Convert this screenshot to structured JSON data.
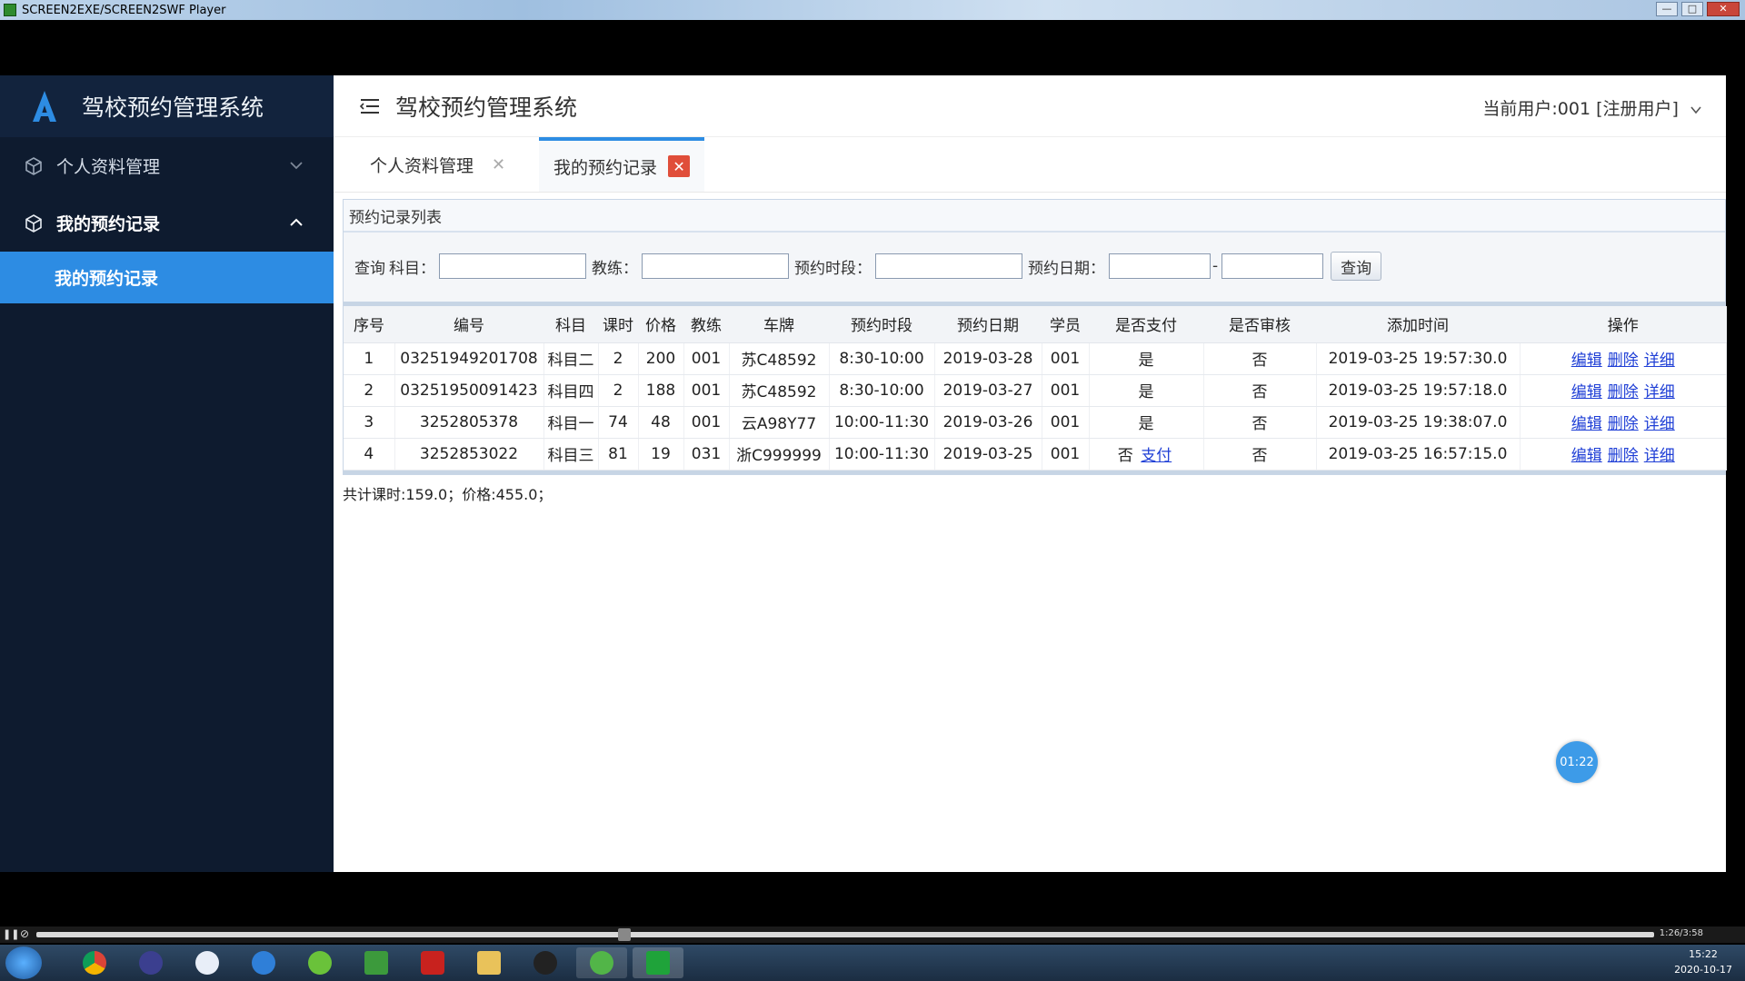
{
  "window": {
    "title": "SCREEN2EXE/SCREEN2SWF Player"
  },
  "sidebar": {
    "brand": "驾校预约管理系统",
    "items": [
      {
        "label": "个人资料管理"
      },
      {
        "label": "我的预约记录"
      }
    ],
    "sub_item": "我的预约记录"
  },
  "header": {
    "title": "驾校预约管理系统",
    "user": "当前用户:001 [注册用户]"
  },
  "tabs": [
    {
      "label": "个人资料管理",
      "close": "✕"
    },
    {
      "label": "我的预约记录",
      "close": "✕"
    }
  ],
  "panel": {
    "title": "预约记录列表",
    "search": {
      "prefix": "查询",
      "subject_label": "科目：",
      "coach_label": "教练：",
      "period_label": "预约时段：",
      "date_label": "预约日期：",
      "date_sep": "-",
      "button": "查询"
    }
  },
  "table": {
    "columns": [
      "序号",
      "编号",
      "科目",
      "课时",
      "价格",
      "教练",
      "车牌",
      "预约时段",
      "预约日期",
      "学员",
      "是否支付",
      "是否审核",
      "添加时间",
      "操作"
    ],
    "rows": [
      {
        "no": "1",
        "code": "03251949201708",
        "subject": "科目二",
        "hours": "2",
        "price": "200",
        "coach": "001",
        "plate": "苏C48592",
        "period": "8:30-10:00",
        "date": "2019-03-28",
        "student": "001",
        "paid": "是",
        "pay_link": "",
        "audited": "否",
        "added": "2019-03-25 19:57:30.0"
      },
      {
        "no": "2",
        "code": "03251950091423",
        "subject": "科目四",
        "hours": "2",
        "price": "188",
        "coach": "001",
        "plate": "苏C48592",
        "period": "8:30-10:00",
        "date": "2019-03-27",
        "student": "001",
        "paid": "是",
        "pay_link": "",
        "audited": "否",
        "added": "2019-03-25 19:57:18.0"
      },
      {
        "no": "3",
        "code": "3252805378",
        "subject": "科目一",
        "hours": "74",
        "price": "48",
        "coach": "001",
        "plate": "云A98Y77",
        "period": "10:00-11:30",
        "date": "2019-03-26",
        "student": "001",
        "paid": "是",
        "pay_link": "",
        "audited": "否",
        "added": "2019-03-25 19:38:07.0"
      },
      {
        "no": "4",
        "code": "3252853022",
        "subject": "科目三",
        "hours": "81",
        "price": "19",
        "coach": "031",
        "plate": "浙C999999",
        "period": "10:00-11:30",
        "date": "2019-03-25",
        "student": "001",
        "paid": "否",
        "pay_link": "支付",
        "audited": "否",
        "added": "2019-03-25 16:57:15.0"
      }
    ],
    "actions": [
      "编辑",
      "删除",
      "详细"
    ]
  },
  "summary": "共计课时:159.0；价格:455.0；",
  "timer": "01:22",
  "player": {
    "time": "1:26/3:58"
  },
  "tray": {
    "time": "15:22",
    "date": "2020-10-17"
  }
}
